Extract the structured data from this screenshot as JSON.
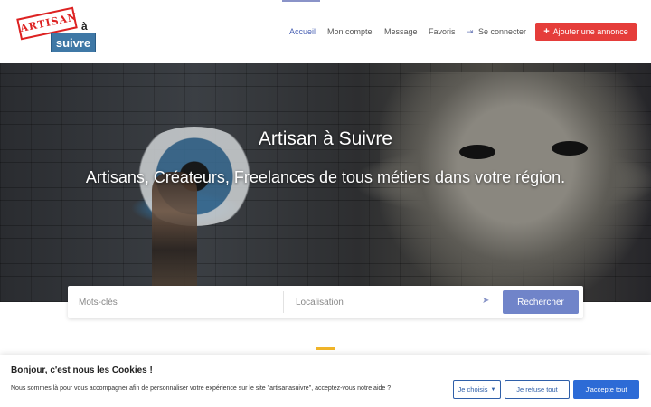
{
  "header": {
    "logo_text_top": "ARTISAN",
    "logo_text_a": "à",
    "logo_text_bottom": "suivre",
    "nav": [
      {
        "label": "Accueil",
        "active": true
      },
      {
        "label": "Mon compte",
        "active": false
      },
      {
        "label": "Message",
        "active": false
      },
      {
        "label": "Favoris",
        "active": false
      },
      {
        "label": "Se connecter",
        "active": false
      }
    ],
    "add_button": "Ajouter une annonce"
  },
  "hero": {
    "title": "Artisan à Suivre",
    "subtitle": "Artisans, Créateurs, Freelances de tous métiers dans votre région."
  },
  "search": {
    "keywords_placeholder": "Mots-clés",
    "location_placeholder": "Localisation",
    "button": "Rechercher"
  },
  "cookie": {
    "title": "Bonjour, c'est nous les Cookies !",
    "text": "Nous sommes là pour vous accompagner afin de personnaliser votre expérience sur le site \"artisanasuivre\", acceptez-vous notre aide ?",
    "choose": "Je choisis",
    "refuse": "Je refuse tout",
    "accept": "J'accepte tout"
  },
  "colors": {
    "accent_red": "#e53d3a",
    "search_button": "#7084c9",
    "accept_button": "#2d6bd6",
    "underline_accent": "#f0b429"
  }
}
